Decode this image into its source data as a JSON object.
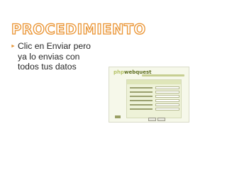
{
  "slide": {
    "title": "PROCEDIMIENTO",
    "bullet_lines": [
      "Clic en Enviar pero",
      "ya lo envias con",
      "todos tus datos"
    ]
  },
  "screenshot": {
    "logo_left": "php",
    "logo_right": "webquest"
  },
  "colors": {
    "title_outline": "#ea9433",
    "bullet_marker": "#e69535",
    "text": "#262626",
    "screenshot_bg": "#f6f8ea",
    "logo_green": "#5f6f22"
  },
  "icons": {
    "bullet": "arrow-bullet-icon"
  }
}
